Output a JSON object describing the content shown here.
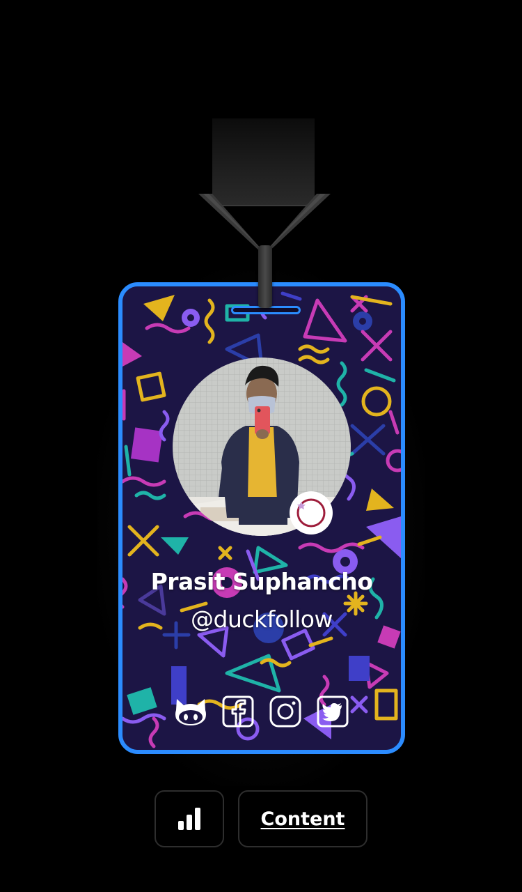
{
  "profile": {
    "name": "Prasit Suphancho",
    "handle": "@duckfollow"
  },
  "socials": [
    {
      "icon": "github-icon"
    },
    {
      "icon": "facebook-icon"
    },
    {
      "icon": "instagram-icon"
    },
    {
      "icon": "twitter-icon"
    }
  ],
  "buttons": {
    "stats_icon": "bar-chart-icon",
    "content_label": "Content"
  },
  "colors": {
    "background": "#000000",
    "card_border": "#2b8cff",
    "card_background": "#1c1545",
    "pattern_pink": "#c73bb5",
    "pattern_yellow": "#e3b41e",
    "pattern_teal": "#1fb3a8",
    "pattern_purple": "#8a5cf0",
    "text": "#ffffff"
  }
}
